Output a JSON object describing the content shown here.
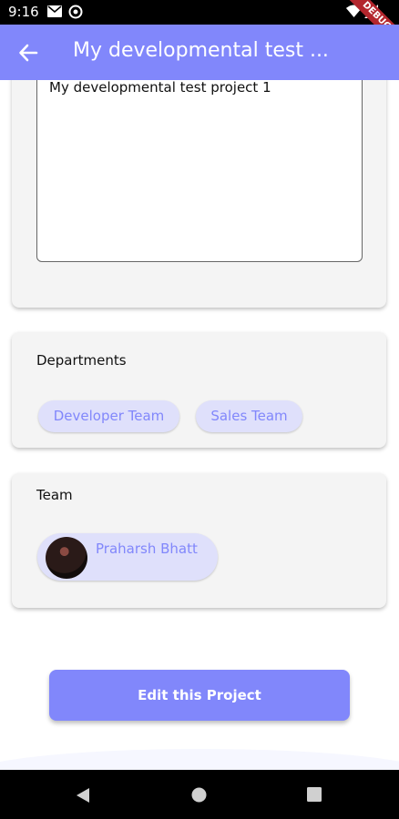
{
  "status_bar": {
    "time": "9:16"
  },
  "debug_ribbon": {
    "label": "DEBUG"
  },
  "app_bar": {
    "title": "My developmental test ..."
  },
  "description": {
    "text": "My developmental test project 1"
  },
  "departments": {
    "title": "Departments",
    "chips": [
      "Developer Team",
      "Sales Team"
    ]
  },
  "team": {
    "title": "Team",
    "members": [
      {
        "name": "Praharsh Bhatt"
      }
    ]
  },
  "actions": {
    "edit_label": "Edit this Project"
  },
  "colors": {
    "accent": "#8187fb",
    "chip_bg": "#dfe0fb",
    "card_bg": "#f4f4f4"
  }
}
